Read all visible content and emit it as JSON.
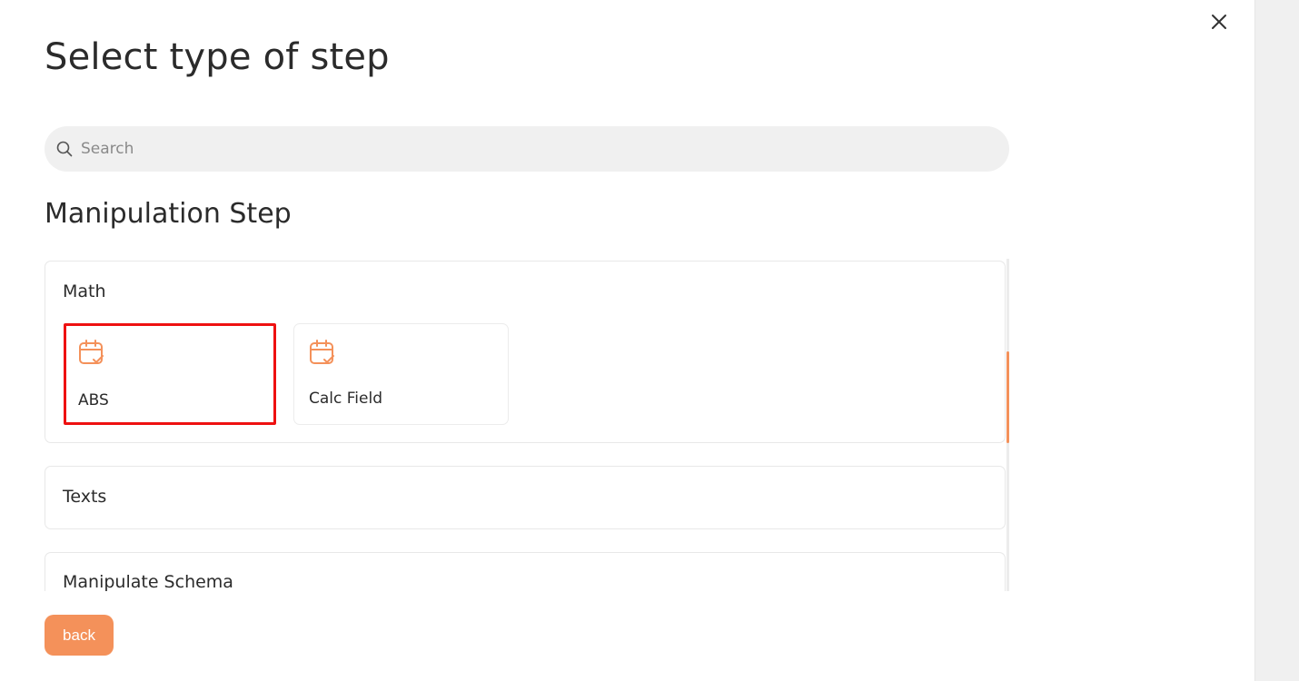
{
  "dialog": {
    "title": "Select type of step",
    "close_icon": "close-icon"
  },
  "search": {
    "placeholder": "Search",
    "value": "",
    "icon": "search-icon"
  },
  "section": {
    "title": "Manipulation Step"
  },
  "groups": [
    {
      "title": "Math",
      "expanded": true,
      "items": [
        {
          "label": "ABS",
          "icon": "calendar-check-icon",
          "highlighted": true
        },
        {
          "label": "Calc Field",
          "icon": "calendar-check-icon",
          "highlighted": false
        }
      ]
    },
    {
      "title": "Texts",
      "expanded": false,
      "items": []
    },
    {
      "title": "Manipulate Schema",
      "expanded": false,
      "items": []
    }
  ],
  "footer": {
    "back_label": "back"
  },
  "colors": {
    "accent": "#f4915a",
    "highlight_border": "#ee1111",
    "search_bg": "#f0f0f0",
    "gutter_bg": "#f0f0f0"
  }
}
